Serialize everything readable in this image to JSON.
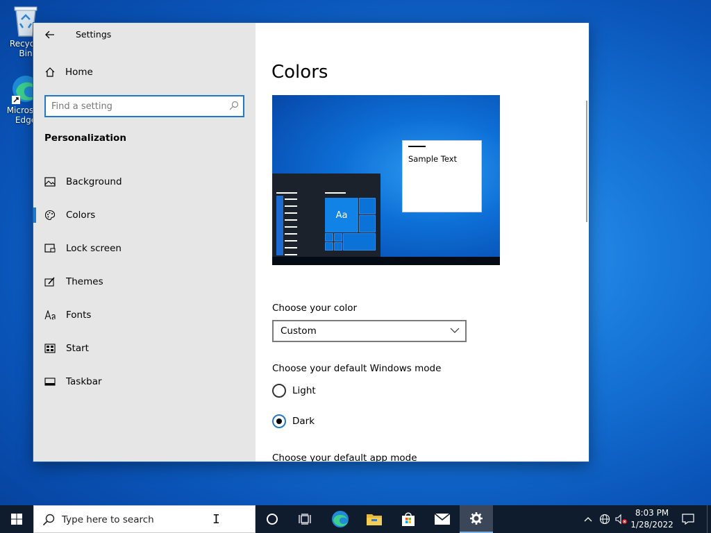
{
  "desktop": {
    "icons": [
      {
        "label": "Recycle Bin"
      },
      {
        "label": "Microsoft Edge"
      }
    ]
  },
  "window": {
    "title": "Settings",
    "home_label": "Home",
    "search_placeholder": "Find a setting",
    "section_heading": "Personalization",
    "nav_items": [
      {
        "label": "Background",
        "icon": "picture-icon",
        "selected": false
      },
      {
        "label": "Colors",
        "icon": "palette-icon",
        "selected": true
      },
      {
        "label": "Lock screen",
        "icon": "lock-screen-icon",
        "selected": false
      },
      {
        "label": "Themes",
        "icon": "brush-icon",
        "selected": false
      },
      {
        "label": "Fonts",
        "icon": "fonts-icon",
        "selected": false
      },
      {
        "label": "Start",
        "icon": "start-icon",
        "selected": false
      },
      {
        "label": "Taskbar",
        "icon": "taskbar-icon",
        "selected": false
      }
    ]
  },
  "content": {
    "title": "Colors",
    "preview": {
      "tile_label": "Aa",
      "sample_text": "Sample Text"
    },
    "choose_color_label": "Choose your color",
    "color_dropdown_value": "Custom",
    "windows_mode_label": "Choose your default Windows mode",
    "windows_mode_options": [
      {
        "label": "Light",
        "checked": false
      },
      {
        "label": "Dark",
        "checked": true
      }
    ],
    "app_mode_label": "Choose your default app mode"
  },
  "taskbar": {
    "search_placeholder": "Type here to search",
    "pinned": [
      "cortana-icon",
      "task-view-icon",
      "edge-icon",
      "file-explorer-icon",
      "store-icon",
      "mail-icon",
      "settings-icon"
    ],
    "active_app": "settings-icon",
    "clock_time": "8:03 PM",
    "clock_date": "1/28/2022"
  },
  "colors": {
    "accent": "#1f78c8",
    "sidebar_bg": "#e6e6e6",
    "taskbar_bg": "#0f1c2e"
  }
}
